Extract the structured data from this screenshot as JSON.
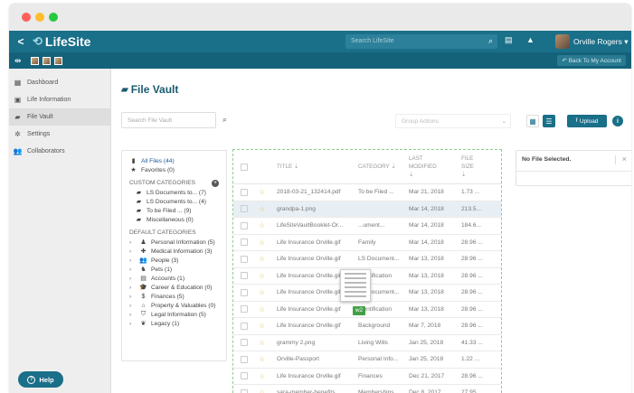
{
  "window": {
    "dots": [
      "#ff5f57",
      "#febc2e",
      "#28c840"
    ]
  },
  "topbar": {
    "back": "<",
    "logo": "LifeSite",
    "search_placeholder": "Search LifeSite",
    "user_name": "Orville Rogers ▾"
  },
  "subbar": {
    "back_account": "↶ Back To My Account"
  },
  "sidebar": {
    "items": [
      {
        "label": "Dashboard",
        "icon": "dashboard-icon"
      },
      {
        "label": "Life Information",
        "icon": "id-card-icon"
      },
      {
        "label": "File Vault",
        "icon": "folder-icon"
      },
      {
        "label": "Settings",
        "icon": "gear-icon"
      },
      {
        "label": "Collaborators",
        "icon": "people-icon"
      }
    ],
    "help": "Help"
  },
  "main": {
    "title": "File Vault",
    "search_placeholder": "Search File Vault",
    "group_actions": "Group Actions",
    "upload": "Upload",
    "info": "i"
  },
  "categories": {
    "all_files": "All Files (44)",
    "favorites": "Favorites (0)",
    "custom_header": "CUSTOM CATEGORIES",
    "custom": [
      "LS Documents to... (7)",
      "LS Documents to... (4)",
      "To be Filed ... (9)",
      "Miscellaneous (0)"
    ],
    "default_header": "DEFAULT CATEGORIES",
    "default": [
      {
        "label": "Personal Information (5)",
        "icon": "person-icon"
      },
      {
        "label": "Medical Information (3)",
        "icon": "medical-icon"
      },
      {
        "label": "People (3)",
        "icon": "people-icon"
      },
      {
        "label": "Pets (1)",
        "icon": "pet-icon"
      },
      {
        "label": "Accounts (1)",
        "icon": "accounts-icon"
      },
      {
        "label": "Career & Education (0)",
        "icon": "graduation-icon"
      },
      {
        "label": "Finances (5)",
        "icon": "dollar-icon"
      },
      {
        "label": "Property & Valuables (0)",
        "icon": "house-icon"
      },
      {
        "label": "Legal Information (5)",
        "icon": "shield-icon"
      },
      {
        "label": "Legacy (1)",
        "icon": "legacy-icon"
      }
    ]
  },
  "file_list": {
    "headers": {
      "title": "TITLE",
      "category": "CATEGORY",
      "modified_1": "LAST",
      "modified_2": "MODIFIED",
      "size_1": "FILE",
      "size_2": "SIZE"
    },
    "rows": [
      {
        "title": "2018-03-21_132414.pdf",
        "category": "To be Filed ...",
        "modified": "Mar 21, 2018",
        "size": "1.73 ..."
      },
      {
        "title": "grandpa-1.png",
        "category": "",
        "modified": "Mar 14, 2018",
        "size": "213.5..."
      },
      {
        "title": "LifeSiteVaultBooklet-Or...",
        "category": "...ument...",
        "modified": "Mar 14, 2018",
        "size": "184.6..."
      },
      {
        "title": "Life Insurance Orville.gif",
        "category": "Family",
        "modified": "Mar 14, 2018",
        "size": "28.96 ..."
      },
      {
        "title": "Life Insurance Orville.gif",
        "category": "LS Document...",
        "modified": "Mar 13, 2018",
        "size": "28.96 ..."
      },
      {
        "title": "Life Insurance Orville.gif",
        "category": "Identification",
        "modified": "Mar 13, 2018",
        "size": "28.96 ..."
      },
      {
        "title": "Life Insurance Orville.gif",
        "category": "LS Document...",
        "modified": "Mar 13, 2018",
        "size": "28.96 ..."
      },
      {
        "title": "Life Insurance Orville.gif",
        "category": "Identification",
        "modified": "Mar 13, 2018",
        "size": "28.96 ..."
      },
      {
        "title": "Life Insurance Orville.gif",
        "category": "Background",
        "modified": "Mar 7, 2018",
        "size": "28.96 ..."
      },
      {
        "title": "grammy 2.png",
        "category": "Living Wills",
        "modified": "Jan 25, 2018",
        "size": "41.33 ..."
      },
      {
        "title": "Orville-Passport",
        "category": "Personal Info...",
        "modified": "Jan 25, 2018",
        "size": "1.22 ..."
      },
      {
        "title": "Life Insurance Orville.gif",
        "category": "Finances",
        "modified": "Dec 21, 2017",
        "size": "28.96 ..."
      },
      {
        "title": "sara-member-benefits",
        "category": "Memberships",
        "modified": "Dec 8, 2017",
        "size": "27.95 ..."
      }
    ],
    "drag_badge": "w2"
  },
  "detail": {
    "text": "No File Selected.",
    "close": "×"
  }
}
